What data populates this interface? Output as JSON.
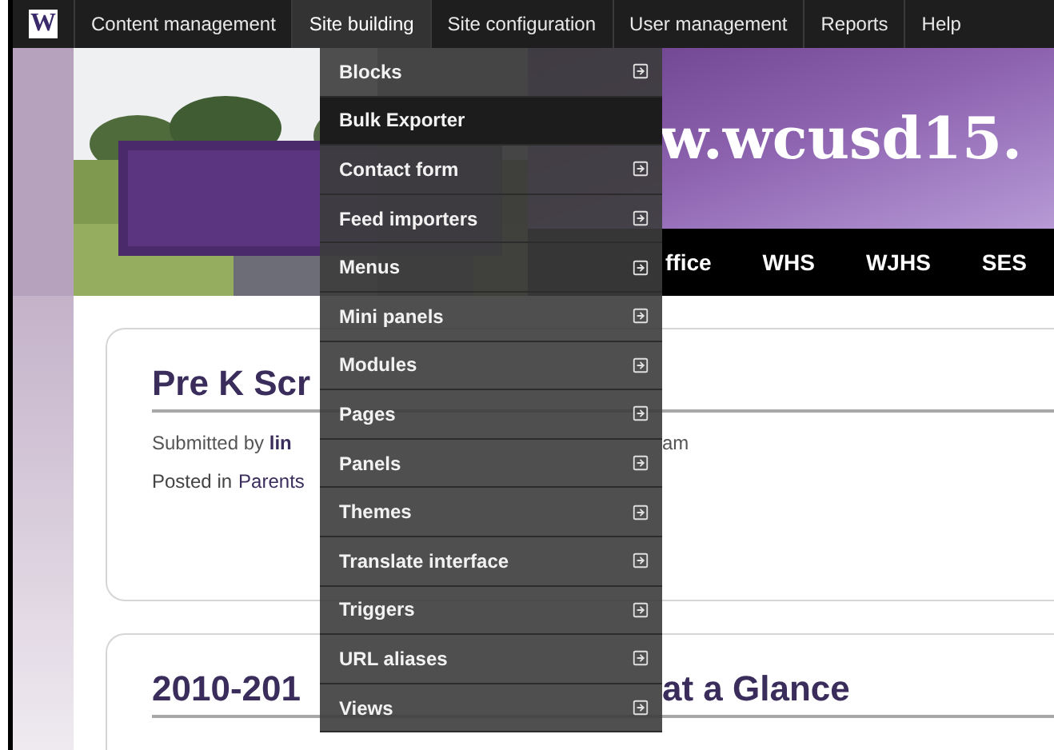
{
  "admin_menu": {
    "logo": "W",
    "items": [
      {
        "label": "Content management",
        "selected": false
      },
      {
        "label": "Site building",
        "selected": true
      },
      {
        "label": "Site configuration",
        "selected": false
      },
      {
        "label": "User management",
        "selected": false
      },
      {
        "label": "Reports",
        "selected": false
      },
      {
        "label": "Help",
        "selected": false
      }
    ]
  },
  "dropdown": [
    {
      "label": "Blocks",
      "submenu": true,
      "selected": false
    },
    {
      "label": "Bulk Exporter",
      "submenu": false,
      "selected": true
    },
    {
      "label": "Contact form",
      "submenu": true,
      "selected": false
    },
    {
      "label": "Feed importers",
      "submenu": true,
      "selected": false
    },
    {
      "label": "Menus",
      "submenu": true,
      "selected": false
    },
    {
      "label": "Mini panels",
      "submenu": true,
      "selected": false
    },
    {
      "label": "Modules",
      "submenu": true,
      "selected": false
    },
    {
      "label": "Pages",
      "submenu": true,
      "selected": false
    },
    {
      "label": "Panels",
      "submenu": true,
      "selected": false
    },
    {
      "label": "Themes",
      "submenu": true,
      "selected": false
    },
    {
      "label": "Translate interface",
      "submenu": true,
      "selected": false
    },
    {
      "label": "Triggers",
      "submenu": true,
      "selected": false
    },
    {
      "label": "URL aliases",
      "submenu": true,
      "selected": false
    },
    {
      "label": "Views",
      "submenu": true,
      "selected": false
    }
  ],
  "header": {
    "banner": "w.wcusd15.",
    "nav": [
      "ffice",
      "WHS",
      "WJHS",
      "SES"
    ]
  },
  "posts": [
    {
      "title": "Pre K Scr",
      "meta": "Submitted by **lin**",
      "meta_continued": "am",
      "posted_in": "Posted in",
      "tags": [
        "Parents"
      ]
    },
    {
      "title": "2010-201",
      "title_continued": "at a Glance"
    }
  ]
}
